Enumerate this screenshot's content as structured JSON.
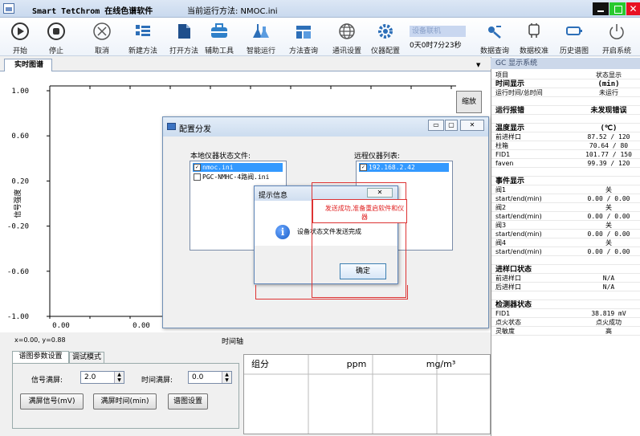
{
  "titlebar": {
    "app_name": "Smart TetChrom 在线色谱软件",
    "method_label": "当前运行方法: NMOC.ini",
    "close_glyph": "✕"
  },
  "toolbar": {
    "items": [
      {
        "label": "开始",
        "icon": "play-icon"
      },
      {
        "label": "停止",
        "icon": "stop-icon"
      },
      {
        "label": "取消",
        "icon": "cancel-icon"
      },
      {
        "label": "新建方法",
        "icon": "new-method-icon"
      },
      {
        "label": "打开方法",
        "icon": "open-method-icon"
      },
      {
        "label": "辅助工具",
        "icon": "toolbox-icon"
      },
      {
        "label": "智能运行",
        "icon": "flask-icon"
      },
      {
        "label": "方法查询",
        "icon": "method-query-icon"
      },
      {
        "label": "通讯设置",
        "icon": "globe-icon"
      },
      {
        "label": "仪器配置",
        "icon": "gear-icon"
      },
      {
        "label": "数据查询",
        "icon": "data-query-icon"
      },
      {
        "label": "数据校准",
        "icon": "calibrate-icon"
      },
      {
        "label": "历史谱图",
        "icon": "history-icon"
      },
      {
        "label": "开启系统",
        "icon": "power-icon"
      }
    ],
    "device_status": "设备联机",
    "elapsed": "0天0时7分23秒"
  },
  "tabs": {
    "realtime": "实时图谱"
  },
  "chart_data": {
    "type": "line",
    "title": "",
    "xlabel": "时间轴",
    "ylabel": "信号强度",
    "y_ticks": [
      "1.00",
      "0.60",
      "0.20",
      "-0.20",
      "-0.60",
      "-1.00"
    ],
    "x_ticks": [
      "0.00",
      "0.00"
    ],
    "ylim": [
      -1.0,
      1.0
    ],
    "series": []
  },
  "chart": {
    "zoom_label": "缩放",
    "coord_readout": "x=0.00, y=0.88"
  },
  "settings": {
    "tab_param": "谱图参数设置",
    "tab_debug": "调试模式",
    "signal_full_label": "信号满屏:",
    "signal_full_value": "2.0",
    "time_full_label": "时间满屏:",
    "time_full_value": "0.0",
    "btn_signal": "满屏信号(mV)",
    "btn_time": "满屏时间(min)",
    "btn_graph": "谱图设置"
  },
  "conc_table": {
    "col1": "组分",
    "col2": "ppm",
    "col3": "mg/m³"
  },
  "right_panel": {
    "header": "GC 显示系统",
    "rows": [
      {
        "k": "项目",
        "v": "状态显示",
        "sec": false
      },
      {
        "k": "时间显示",
        "v": "(min)",
        "sec": true
      },
      {
        "k": "运行时间/总时间",
        "v": "未运行",
        "sec": false
      },
      {
        "k": "",
        "v": "",
        "sec": false
      },
      {
        "k": "运行报错",
        "v": "未发现错误",
        "sec": true
      },
      {
        "k": "",
        "v": "",
        "sec": false
      },
      {
        "k": "温度显示",
        "v": "(℃)",
        "sec": true
      },
      {
        "k": "前进样口",
        "v": "87.52 / 120",
        "sec": false
      },
      {
        "k": "柱箱",
        "v": "70.64 / 80",
        "sec": false
      },
      {
        "k": "FID1",
        "v": "101.77 / 150",
        "sec": false
      },
      {
        "k": "faven",
        "v": "99.39 / 120",
        "sec": false
      },
      {
        "k": "",
        "v": "",
        "sec": false
      },
      {
        "k": "事件显示",
        "v": "",
        "sec": true
      },
      {
        "k": "阀1",
        "v": "关",
        "sec": false
      },
      {
        "k": "start/end(min)",
        "v": "0.00 / 0.00",
        "sec": false
      },
      {
        "k": "阀2",
        "v": "关",
        "sec": false
      },
      {
        "k": "start/end(min)",
        "v": "0.00 / 0.00",
        "sec": false
      },
      {
        "k": "阀3",
        "v": "关",
        "sec": false
      },
      {
        "k": "start/end(min)",
        "v": "0.00 / 0.00",
        "sec": false
      },
      {
        "k": "阀4",
        "v": "关",
        "sec": false
      },
      {
        "k": "start/end(min)",
        "v": "0.00 / 0.00",
        "sec": false
      },
      {
        "k": "",
        "v": "",
        "sec": false
      },
      {
        "k": "进样口状态",
        "v": "",
        "sec": true
      },
      {
        "k": "前进样口",
        "v": "N/A",
        "sec": false
      },
      {
        "k": "后进样口",
        "v": "N/A",
        "sec": false
      },
      {
        "k": "",
        "v": "",
        "sec": false
      },
      {
        "k": "检测器状态",
        "v": "",
        "sec": true
      },
      {
        "k": "FID1",
        "v": "38.819 mV",
        "sec": false
      },
      {
        "k": "点火状态",
        "v": "点火成功",
        "sec": false
      },
      {
        "k": "灵敏度",
        "v": "高",
        "sec": false
      }
    ]
  },
  "config_dialog": {
    "title": "配置分发",
    "local_label": "本地仪器状态文件:",
    "remote_label": "远程仪器列表:",
    "local_files": [
      {
        "name": "nmoc.ini",
        "checked": true,
        "selected": true
      },
      {
        "name": "PGC-NMHC-4路阀.ini",
        "checked": false,
        "selected": false
      }
    ],
    "remote_list": [
      {
        "name": "192.168.2.42",
        "checked": true,
        "selected": true
      }
    ]
  },
  "message_box": {
    "title": "提示信息",
    "text": "设备状态文件发送完成",
    "ok": "确定",
    "close_glyph": "✕"
  },
  "annotation": {
    "text": "发送成功,准备重启软件和仪器",
    "color": "#e02020"
  }
}
